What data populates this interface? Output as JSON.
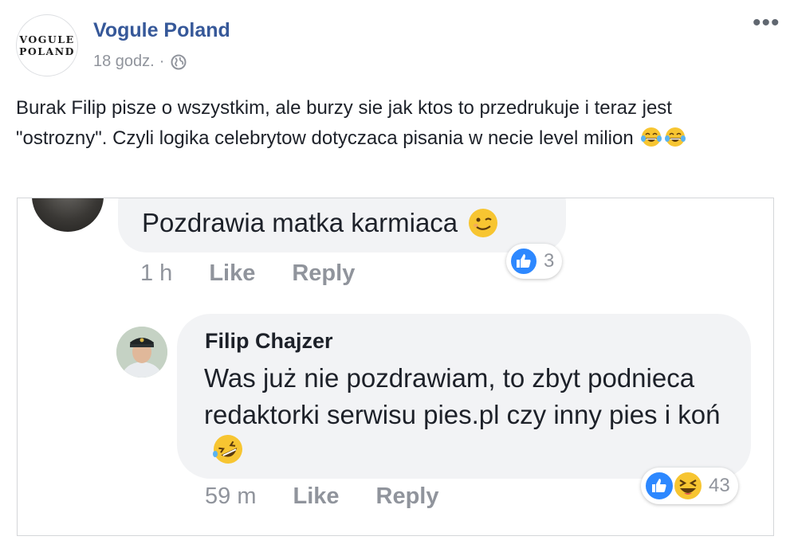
{
  "page": {
    "logo_line1": "VOGULE",
    "logo_line2": "POLAND",
    "name": "Vogule Poland",
    "time": "18 godz.",
    "separator": "·",
    "privacy_icon": "globe-icon",
    "more_label": "•••"
  },
  "post": {
    "text": "Burak Filip pisze o wszystkim, ale burzy sie jak ktos to przedrukuje i teraz jest \"ostrozny\". Czyli logika celebrytow dotyczaca pisania w necie level milion",
    "emojis": [
      "tears-of-joy-icon",
      "tears-of-joy-icon"
    ]
  },
  "screenshot": {
    "comment1": {
      "text": "Pozdrawia matka karmiaca",
      "emoji": "winking-face-icon",
      "time": "1 h",
      "like_label": "Like",
      "reply_label": "Reply",
      "reactions": [
        "like-reaction-icon"
      ],
      "reaction_count": "3"
    },
    "comment2": {
      "author": "Filip Chajzer",
      "text": "Was już nie pozdrawiam, to zbyt podnieca redaktorki serwisu pies.pl czy inny pies  i koń",
      "emoji": "rolling-laughing-icon",
      "time": "59 m",
      "like_label": "Like",
      "reply_label": "Reply",
      "reactions": [
        "like-reaction-icon",
        "haha-reaction-icon"
      ],
      "reaction_count": "43"
    }
  },
  "colors": {
    "link": "#365899",
    "meta": "#90949c",
    "bubble": "#f2f3f5",
    "like_blue": "#2d88ff",
    "haha_yellow": "#f7c531"
  }
}
